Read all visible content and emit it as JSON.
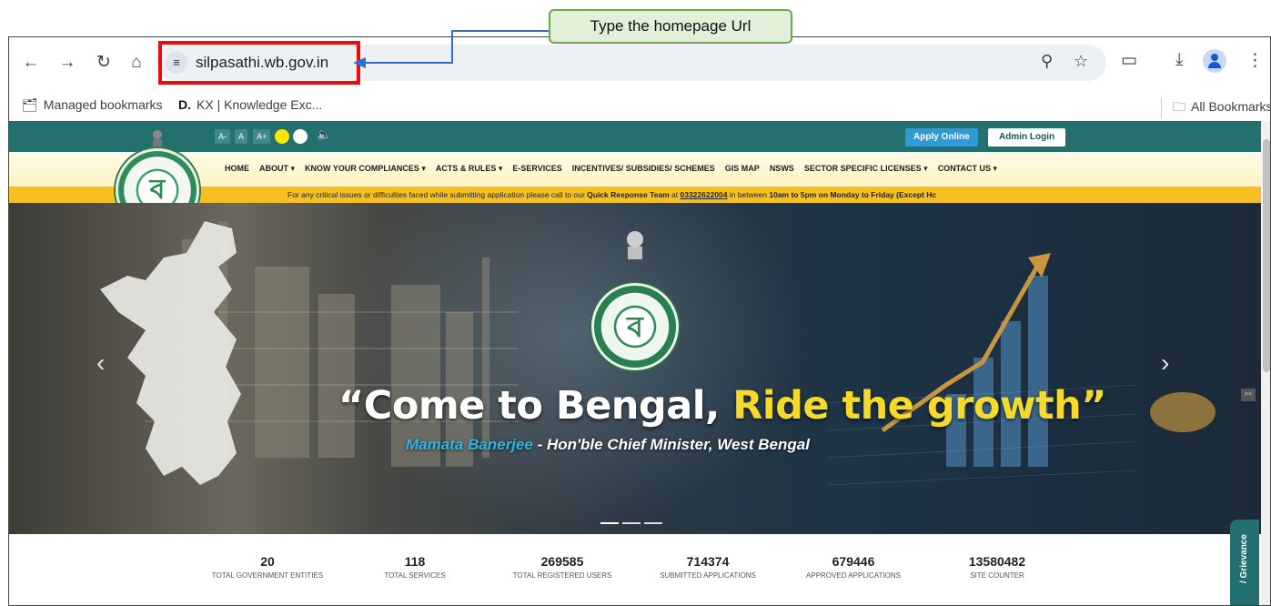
{
  "callout": {
    "text": "Type the homepage Url"
  },
  "browser": {
    "url": "silpasathi.wb.gov.in",
    "bookmarks": [
      {
        "label": "Managed bookmarks",
        "icon": "folder-managed-icon"
      },
      {
        "label": "KX | Knowledge Exc...",
        "icon": "d-logo-icon"
      }
    ],
    "all_bookmarks": "All Bookmarks"
  },
  "site": {
    "a11y": [
      "A-",
      "A",
      "A+"
    ],
    "apply_online": "Apply Online",
    "admin_login": "Admin Login",
    "nav": [
      "HOME",
      "ABOUT ▾",
      "KNOW YOUR COMPLIANCES ▾",
      "ACTS & RULES ▾",
      "E-SERVICES",
      "INCENTIVES/ SUBSIDIES/ SCHEMES",
      "GIS MAP",
      "NSWS",
      "SECTOR SPECIFIC LICENSES ▾",
      "CONTACT US ▾"
    ],
    "notice": {
      "pre": "For any critical issues or difficulties faced while submitting application please call to our ",
      "team": "Quick Response Team",
      "at": " at ",
      "phone": "03322622004",
      "mid": " in between ",
      "hours": "10am to 5pm on Monday to Friday (Except Hc"
    },
    "hero": {
      "title_main": "“Come to Bengal, ",
      "title_highlight": "Ride the growth”",
      "sub_name": "Mamata Banerjee",
      "sub_rest": " - Hon'ble Chief Minister, West Bengal"
    },
    "stats": [
      {
        "value": "20",
        "label": "TOTAL GOVERNMENT ENTITIES"
      },
      {
        "value": "118",
        "label": "TOTAL SERVICES"
      },
      {
        "value": "269585",
        "label": "TOTAL REGISTERED USERS"
      },
      {
        "value": "714374",
        "label": "SUBMITTED APPLICATIONS"
      },
      {
        "value": "679446",
        "label": "APPROVED APPLICATIONS"
      },
      {
        "value": "13580482",
        "label": "SITE COUNTER"
      }
    ],
    "grievance": "/ Grievance",
    "colors": {
      "teal": "#24706f",
      "yellow": "#f6c024",
      "highlight_red": "#e41010"
    }
  }
}
